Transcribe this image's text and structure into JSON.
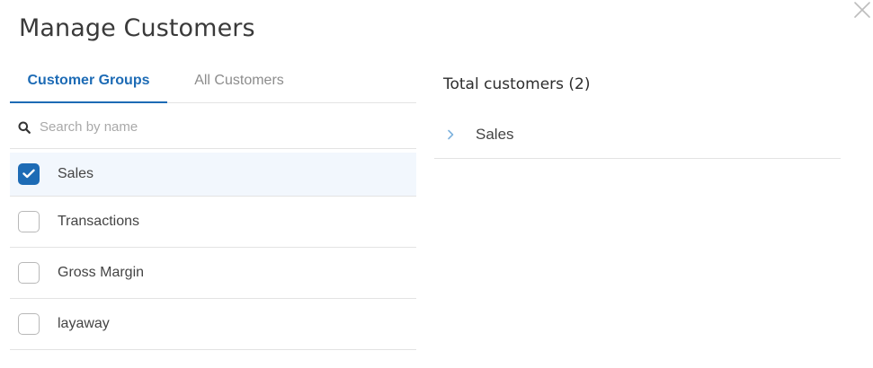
{
  "dialog": {
    "title": "Manage Customers"
  },
  "tabs": [
    {
      "label": "Customer Groups",
      "active": true
    },
    {
      "label": "All Customers",
      "active": false
    }
  ],
  "search": {
    "placeholder": "Search by name",
    "value": ""
  },
  "groups": [
    {
      "label": "Sales",
      "checked": true
    },
    {
      "label": "Transactions",
      "checked": false
    },
    {
      "label": "Gross Margin",
      "checked": false
    },
    {
      "label": "layaway",
      "checked": false
    }
  ],
  "summary": {
    "total_label": "Total customers (2)",
    "selected_items": [
      {
        "label": "Sales"
      }
    ]
  },
  "icons": {
    "close": "close-icon",
    "search": "search-icon",
    "check": "check-icon",
    "chevron": "chevron-right-icon"
  },
  "colors": {
    "accent": "#1d6bb5",
    "selected_row_bg": "#f2f7fd",
    "divider": "#e3e3e3",
    "chevron": "#7fb3de"
  }
}
